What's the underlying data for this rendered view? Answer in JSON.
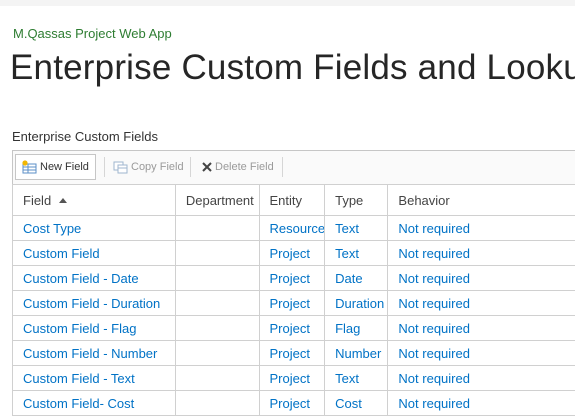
{
  "site": {
    "title": "M.Qassas Project Web App"
  },
  "page": {
    "title": "Enterprise Custom Fields and Lookup"
  },
  "section": {
    "label": "Enterprise Custom Fields"
  },
  "toolbar": {
    "new_field": {
      "label": "New Field",
      "icon": "new-field-icon",
      "enabled": true
    },
    "copy_field": {
      "label": "Copy Field",
      "icon": "copy-icon",
      "enabled": false
    },
    "delete_field": {
      "label": "Delete Field",
      "icon": "delete-x-icon",
      "enabled": false
    }
  },
  "table": {
    "sort": {
      "column": "Field",
      "direction": "ascending"
    },
    "headers": {
      "field": "Field",
      "department": "Department",
      "entity": "Entity",
      "type": "Type",
      "behavior": "Behavior"
    },
    "rows": [
      {
        "field": "Cost Type",
        "department": "",
        "entity": "Resource",
        "type": "Text",
        "behavior": "Not required"
      },
      {
        "field": "Custom Field",
        "department": "",
        "entity": "Project",
        "type": "Text",
        "behavior": "Not required"
      },
      {
        "field": "Custom Field - Date",
        "department": "",
        "entity": "Project",
        "type": "Date",
        "behavior": "Not required"
      },
      {
        "field": "Custom Field - Duration",
        "department": "",
        "entity": "Project",
        "type": "Duration",
        "behavior": "Not required"
      },
      {
        "field": "Custom Field - Flag",
        "department": "",
        "entity": "Project",
        "type": "Flag",
        "behavior": "Not required"
      },
      {
        "field": "Custom Field - Number",
        "department": "",
        "entity": "Project",
        "type": "Number",
        "behavior": "Not required"
      },
      {
        "field": "Custom Field - Text",
        "department": "",
        "entity": "Project",
        "type": "Text",
        "behavior": "Not required"
      },
      {
        "field": "Custom Field- Cost",
        "department": "",
        "entity": "Project",
        "type": "Cost",
        "behavior": "Not required"
      }
    ]
  },
  "colors": {
    "link": "#0072c6",
    "site_title": "#2e7d32",
    "border": "#d0d0d0"
  }
}
